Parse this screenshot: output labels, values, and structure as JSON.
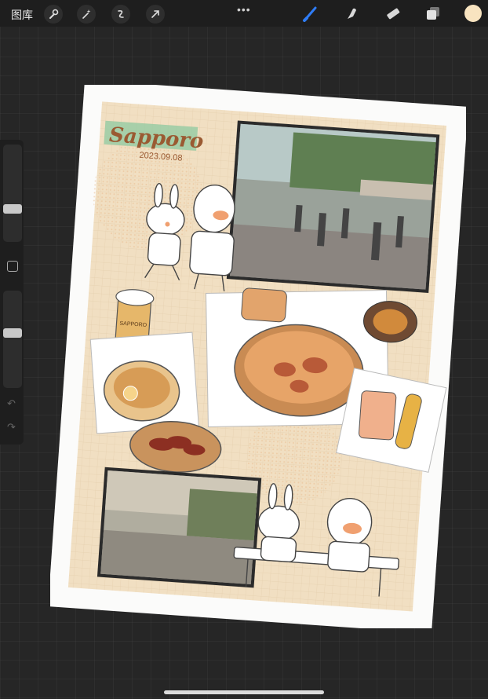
{
  "toolbar": {
    "gallery_label": "图库",
    "left_tools": [
      "wrench-icon",
      "magic-wand-icon",
      "selection-icon",
      "transform-arrow-icon"
    ],
    "more_label": "•••",
    "right_tools": [
      "brush-icon",
      "smudge-icon",
      "eraser-icon",
      "layers-icon"
    ],
    "active_tool": "brush-icon",
    "accent_color": "#2f7cf6",
    "current_color": "#f8e4c0"
  },
  "sidebar": {
    "brush_size_level": 0.55,
    "opacity_level": 0.45,
    "undo_label": "↶",
    "redo_label": "↷"
  },
  "artwork": {
    "title": "Sapporo",
    "date": "2023.09.08",
    "paper_color": "#f1dfc2",
    "beer_can_label": "SAPPORO"
  }
}
